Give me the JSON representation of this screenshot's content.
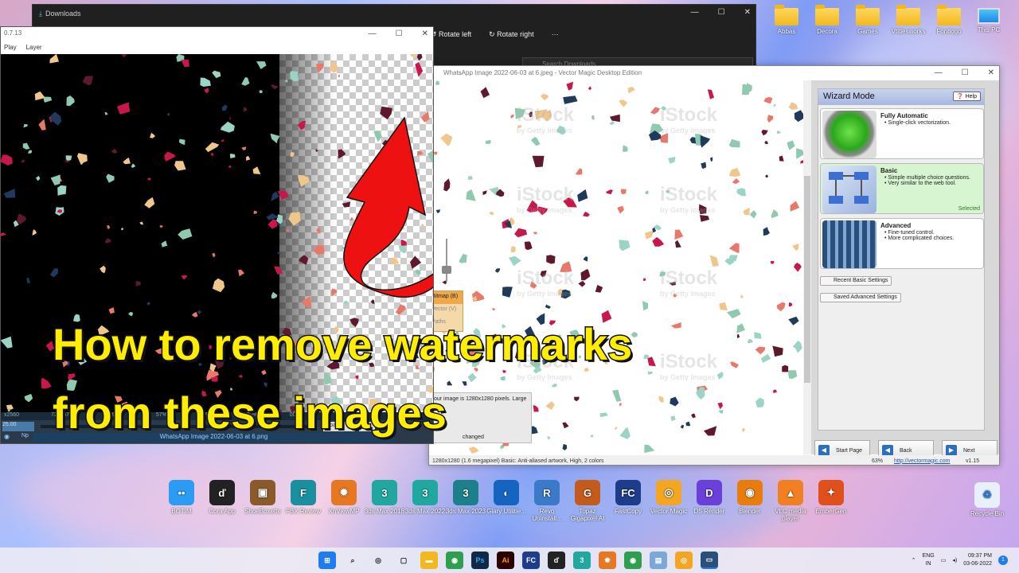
{
  "desktop": {
    "top_icons": [
      {
        "label": "Abbas"
      },
      {
        "label": "Decora"
      },
      {
        "label": "Games"
      },
      {
        "label": "Vtitlesworks"
      },
      {
        "label": "Fontlogo"
      },
      {
        "label": "This PC"
      }
    ],
    "bottom_icons": [
      {
        "label": "BOTIM",
        "color": "#2b9bf4",
        "glyph": "••"
      },
      {
        "label": "Cora App",
        "color": "#222222",
        "glyph": "ď"
      },
      {
        "label": "ShoeBoxette",
        "color": "#8b5a2b",
        "glyph": "▣"
      },
      {
        "label": "FBX Review",
        "color": "#1a8fa0",
        "glyph": "F"
      },
      {
        "label": "XnViewMP",
        "color": "#e87722",
        "glyph": "✹"
      },
      {
        "label": "3ds Max 2018",
        "color": "#1fa7a0",
        "glyph": "3"
      },
      {
        "label": "3ds Max 2022",
        "color": "#1fa7a0",
        "glyph": "3"
      },
      {
        "label": "3ds Max 2023",
        "color": "#1c7f8a",
        "glyph": "3"
      },
      {
        "label": "Glary Utilitie...",
        "color": "#1565c0",
        "glyph": "◐"
      },
      {
        "label": "Revo Uninstall...",
        "color": "#3b7ac9",
        "glyph": "R"
      },
      {
        "label": "Topaz Gigapixel AI",
        "color": "#c25b1b",
        "glyph": "G"
      },
      {
        "label": "FastCopy",
        "color": "#1e3c8c",
        "glyph": "FC"
      },
      {
        "label": "Vector Magic",
        "color": "#f4a623",
        "glyph": "◎"
      },
      {
        "label": "D5 Render",
        "color": "#6b3fd9",
        "glyph": "D"
      },
      {
        "label": "Blender",
        "color": "#e87d0d",
        "glyph": "◉"
      },
      {
        "label": "VLC media player",
        "color": "#f08020",
        "glyph": "▲"
      },
      {
        "label": "EmberGen",
        "color": "#e0501c",
        "glyph": "✦"
      }
    ],
    "recycle_bin": "Recycle Bin"
  },
  "downloads_window": {
    "title": "Downloads",
    "rotate_left": "Rotate left",
    "rotate_right": "Rotate right",
    "more": "···",
    "search_placeholder": "Search Downloads"
  },
  "player_window": {
    "version": "0.7.13",
    "menu": [
      "Play",
      "Layer"
    ],
    "status": [
      "x2560",
      "720x576",
      "0.99 fps",
      "57%",
      "30%",
      "1.00%",
      "0000"
    ],
    "time": "25.00",
    "filename": "WhatsApp Image 2022-06-03 at 6.png",
    "np_label": "Np",
    "board_btn": "rboard",
    "ok_btn": "00"
  },
  "vector_magic": {
    "title": "WhatsApp Image 2022-06-03 at 6.jpeg - Vector Magic Desktop Edition",
    "watermark": "iStock",
    "watermark_sub": "by Getty Images",
    "wizard_mode": "Wizard Mode",
    "help": "Help",
    "options": [
      {
        "title": "Fully Automatic",
        "bullets": [
          "Single-click vectorization."
        ],
        "selected": false
      },
      {
        "title": "Basic",
        "bullets": [
          "Simple multiple choice questions.",
          "Very similar to the web tool."
        ],
        "selected": true
      },
      {
        "title": "Advanced",
        "bullets": [
          "Fine-tuned control.",
          "More complicated choices."
        ],
        "selected": false
      }
    ],
    "selected_label": "Selected",
    "recent_basic": "Recent Basic Settings",
    "saved_advanced": "Saved Advanced Settings",
    "start_page": "Start Page",
    "back": "Back",
    "next": "Next",
    "side_tabs": [
      "Bitmap (B)",
      "Vector (V)",
      "Paths"
    ],
    "info_text": "our image is 1280x1280 pixels. Large",
    "unchanged": "changed",
    "status_left": "1280x1280 (1.6 megapixel)  Basic: Anti-aliased artwork, High, 2 colors",
    "zoom": "63%",
    "url": "http://vectormagic.com",
    "version": "v1.15"
  },
  "caption": {
    "line1": "How to remove watermarks",
    "line2": "from these images"
  },
  "taskbar": {
    "lang": "ENG",
    "region": "IN",
    "time": "09:37 PM",
    "date": "03-06-2022",
    "notif": "1"
  }
}
